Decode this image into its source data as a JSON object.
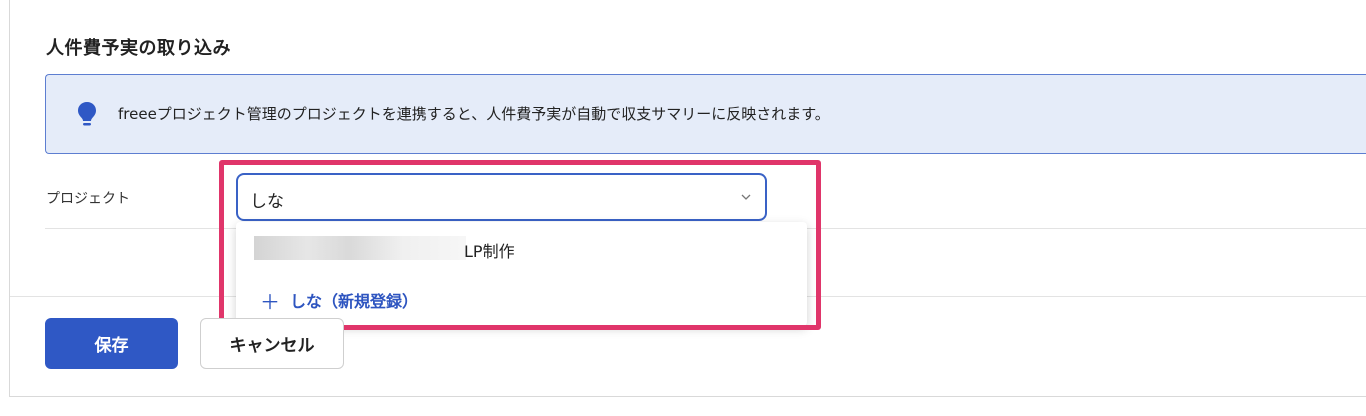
{
  "section": {
    "title": "人件費予実の取り込み"
  },
  "info": {
    "icon": "lightbulb-icon",
    "text": "freeeプロジェクト管理のプロジェクトを連携すると、人件費予実が自動で収支サマリーに反映されます。"
  },
  "project_field": {
    "label": "プロジェクト",
    "value": "しな",
    "chevron_icon": "chevron-down-icon"
  },
  "dropdown": {
    "options": [
      {
        "label": "LP制作"
      }
    ],
    "add_new": {
      "icon": "plus-icon",
      "label": "しな（新規登録）"
    }
  },
  "actions": {
    "save_label": "保存",
    "cancel_label": "キャンセル"
  },
  "colors": {
    "primary": "#2f58c5",
    "highlight": "#e0356a",
    "info_bg": "#e5ecf9"
  }
}
